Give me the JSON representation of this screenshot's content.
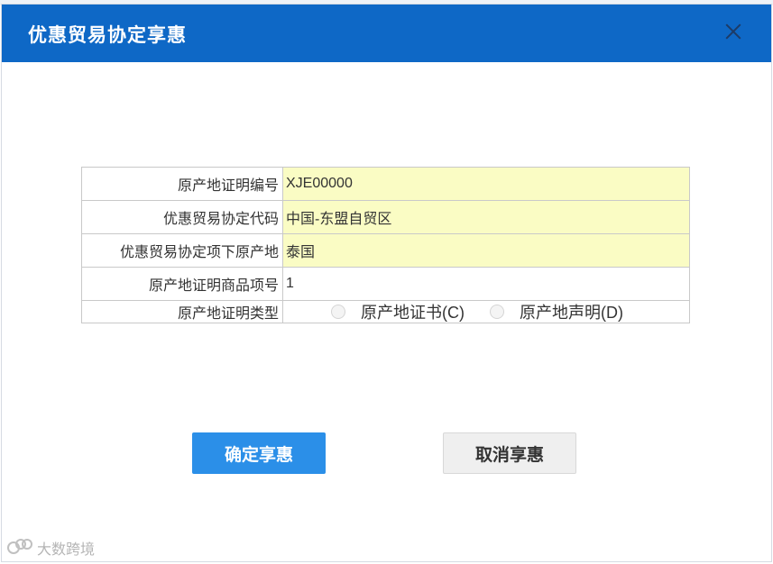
{
  "dialog": {
    "title": "优惠贸易协定享惠",
    "close_icon": "close-icon"
  },
  "form": {
    "rows": [
      {
        "label": "原产地证明编号",
        "value": "XJE00000"
      },
      {
        "label": "优惠贸易协定代码",
        "value": "中国-东盟自贸区"
      },
      {
        "label": "优惠贸易协定项下原产地",
        "value": "泰国"
      },
      {
        "label": "原产地证明商品项号",
        "value": "1"
      }
    ],
    "type_row": {
      "label": "原产地证明类型",
      "options": [
        "原产地证书(C)",
        "原产地声明(D)"
      ]
    }
  },
  "buttons": {
    "confirm": "确定享惠",
    "cancel": "取消享惠"
  },
  "watermark": {
    "text": "大数跨境"
  },
  "colors": {
    "titlebar": "#0e68c6",
    "confirm_button": "#2b8fe8",
    "highlight_field": "#fafcc4"
  }
}
